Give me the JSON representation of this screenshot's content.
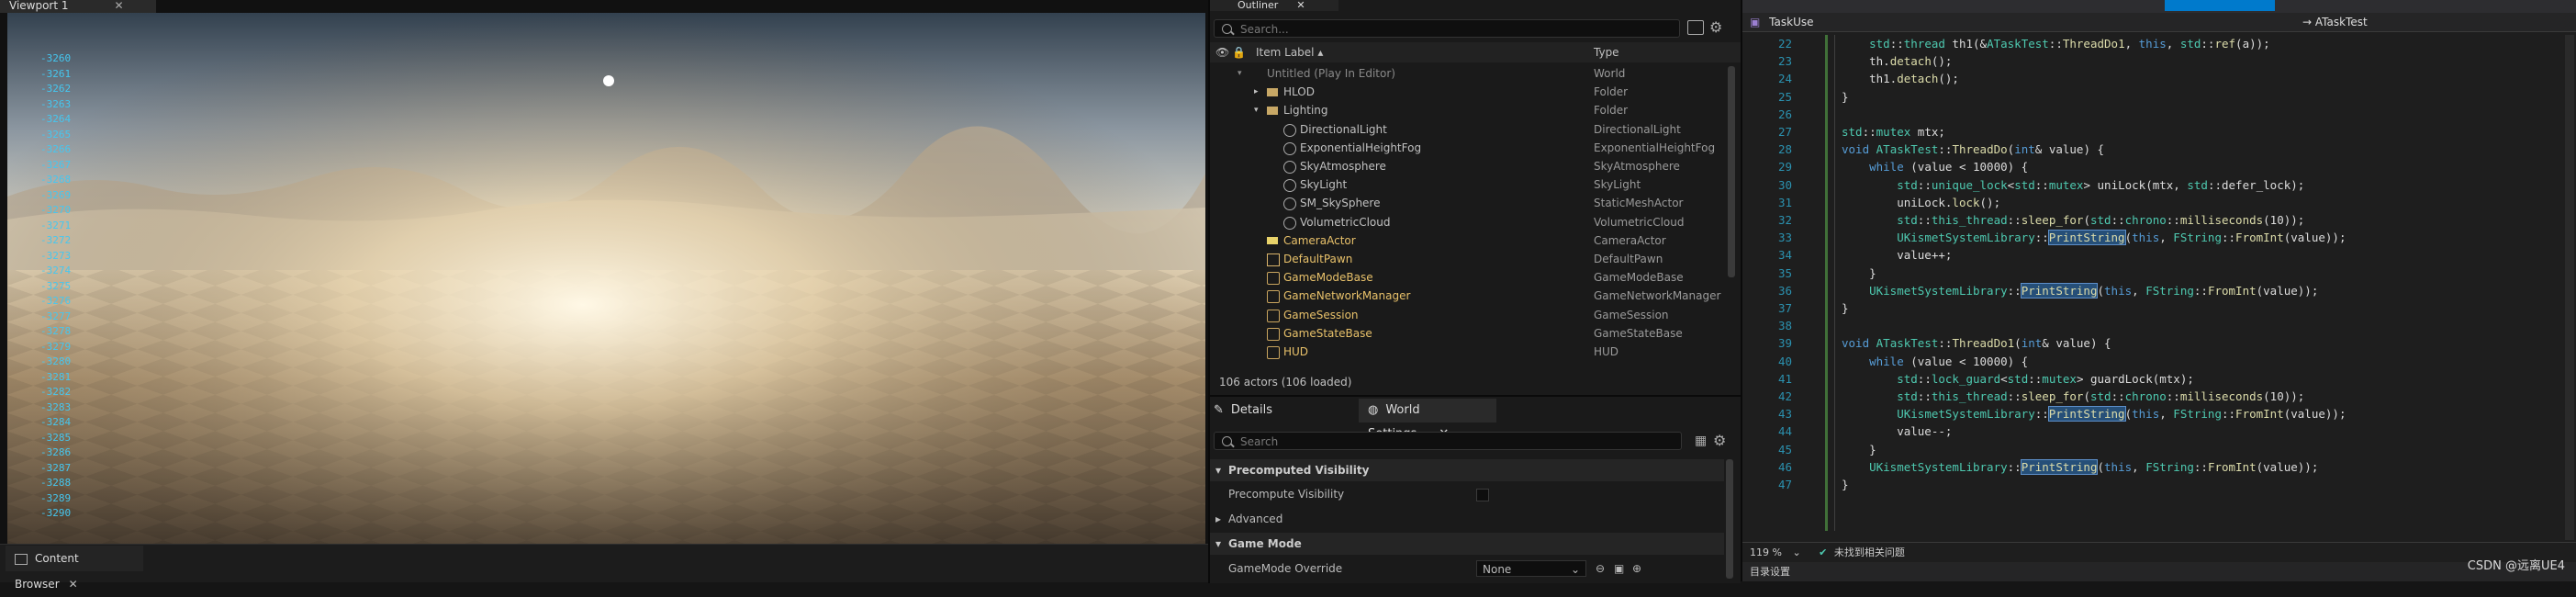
{
  "viewport": {
    "tab_label": "Viewport 1",
    "log_lines": [
      "-3260",
      "-3261",
      "-3262",
      "-3263",
      "-3264",
      "-3265",
      "-3266",
      "-3267",
      "-3268",
      "-3269",
      "-3270",
      "-3271",
      "-3272",
      "-3273",
      "-3274",
      "-3275",
      "-3276",
      "-3277",
      "-3278",
      "-3279",
      "-3280",
      "-3281",
      "-3282",
      "-3283",
      "-3284",
      "-3285",
      "-3286",
      "-3287",
      "-3288",
      "-3289",
      "-3290"
    ]
  },
  "content_browser": {
    "tab_label": "Content Browser"
  },
  "outliner": {
    "tab_label": "Outliner",
    "search_placeholder": "Search...",
    "col_item_label": "Item Label ▴",
    "col_type": "Type",
    "rows": [
      {
        "label": "Untitled (Play In Editor)",
        "type": "World"
      },
      {
        "label": "HLOD",
        "type": "Folder"
      },
      {
        "label": "Lighting",
        "type": "Folder"
      },
      {
        "label": "DirectionalLight",
        "type": "DirectionalLight"
      },
      {
        "label": "ExponentialHeightFog",
        "type": "ExponentialHeightFog"
      },
      {
        "label": "SkyAtmosphere",
        "type": "SkyAtmosphere"
      },
      {
        "label": "SkyLight",
        "type": "SkyLight"
      },
      {
        "label": "SM_SkySphere",
        "type": "StaticMeshActor"
      },
      {
        "label": "VolumetricCloud",
        "type": "VolumetricCloud"
      },
      {
        "label": "CameraActor",
        "type": "CameraActor"
      },
      {
        "label": "DefaultPawn",
        "type": "DefaultPawn"
      },
      {
        "label": "GameModeBase",
        "type": "GameModeBase"
      },
      {
        "label": "GameNetworkManager",
        "type": "GameNetworkManager"
      },
      {
        "label": "GameSession",
        "type": "GameSession"
      },
      {
        "label": "GameStateBase",
        "type": "GameStateBase"
      },
      {
        "label": "HUD",
        "type": "HUD"
      }
    ],
    "footer": "106 actors (106 loaded)"
  },
  "details": {
    "tab_details": "Details",
    "tab_world_settings": "World Settings",
    "search_placeholder": "Search",
    "sec_precomputed": "Precomputed Visibility",
    "prop_precompute": "Precompute Visibility",
    "sec_advanced": "Advanced",
    "sec_game_mode": "Game Mode",
    "prop_game_mode_override": "GameMode Override",
    "game_mode_value": "None"
  },
  "code": {
    "file_tab": "TaskUse",
    "scope": "ATaskTest",
    "zoom": "119 %",
    "status": "未找到相关问题",
    "bottom": "目录设置",
    "lines": [
      {
        "n": "22",
        "t": "    std::thread th1(&ATaskTest::ThreadDo1, this, std::ref(a));"
      },
      {
        "n": "23",
        "t": "    th.detach();"
      },
      {
        "n": "24",
        "t": "    th1.detach();"
      },
      {
        "n": "25",
        "t": "}"
      },
      {
        "n": "26",
        "t": ""
      },
      {
        "n": "27",
        "t": "std::mutex mtx;"
      },
      {
        "n": "28",
        "t": "void ATaskTest::ThreadDo(int& value) {"
      },
      {
        "n": "29",
        "t": "    while (value < 10000) {"
      },
      {
        "n": "30",
        "t": "        std::unique_lock<std::mutex> uniLock(mtx, std::defer_lock);"
      },
      {
        "n": "31",
        "t": "        uniLock.lock();"
      },
      {
        "n": "32",
        "t": "        std::this_thread::sleep_for(std::chrono::milliseconds(10));"
      },
      {
        "n": "33",
        "t": "        UKismetSystemLibrary::PrintString(this, FString::FromInt(value));"
      },
      {
        "n": "34",
        "t": "        value++;"
      },
      {
        "n": "35",
        "t": "    }"
      },
      {
        "n": "36",
        "t": "    UKismetSystemLibrary::PrintString(this, FString::FromInt(value));"
      },
      {
        "n": "37",
        "t": "}"
      },
      {
        "n": "38",
        "t": ""
      },
      {
        "n": "39",
        "t": "void ATaskTest::ThreadDo1(int& value) {"
      },
      {
        "n": "40",
        "t": "    while (value < 10000) {"
      },
      {
        "n": "41",
        "t": "        std::lock_guard<std::mutex> guardLock(mtx);"
      },
      {
        "n": "42",
        "t": "        std::this_thread::sleep_for(std::chrono::milliseconds(10));"
      },
      {
        "n": "43",
        "t": "        UKismetSystemLibrary::PrintString(this, FString::FromInt(value));"
      },
      {
        "n": "44",
        "t": "        value--;"
      },
      {
        "n": "45",
        "t": "    }"
      },
      {
        "n": "46",
        "t": "    UKismetSystemLibrary::PrintString(this, FString::FromInt(value));"
      },
      {
        "n": "47",
        "t": "}"
      }
    ]
  },
  "watermark": "CSDN @远离UE4"
}
